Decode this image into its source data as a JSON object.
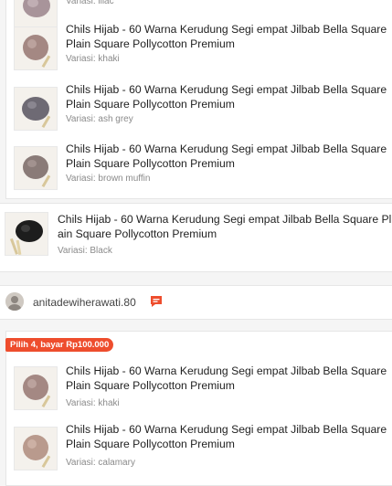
{
  "product_name": "Chils Hijab - 60 Warna Kerudung Segi empat Jilbab Bella Square Plain Square Pollycotton Premium",
  "group1": {
    "items": [
      {
        "variant": "Variasi: lilac"
      },
      {
        "variant": "Variasi: khaki"
      },
      {
        "variant": "Variasi: ash grey"
      },
      {
        "variant": "Variasi: brown muffin"
      }
    ]
  },
  "standalone_item": {
    "variant": "Variasi: Black"
  },
  "seller": {
    "username": "anitadewiherawati.80",
    "icon": "chat-icon"
  },
  "promo": {
    "label": "Pilih 4, bayar Rp100.000"
  },
  "group2": {
    "items": [
      {
        "variant": "Variasi: khaki"
      },
      {
        "variant": "Variasi: calamary"
      }
    ]
  },
  "colors": {
    "accent": "#ee4d2d",
    "lilac": "#a8949a",
    "khaki": "#a48883",
    "ash_grey": "#6e6a74",
    "brown_muffin": "#8a7b78",
    "black": "#1d1d1d",
    "calamary": "#b99a8d"
  }
}
